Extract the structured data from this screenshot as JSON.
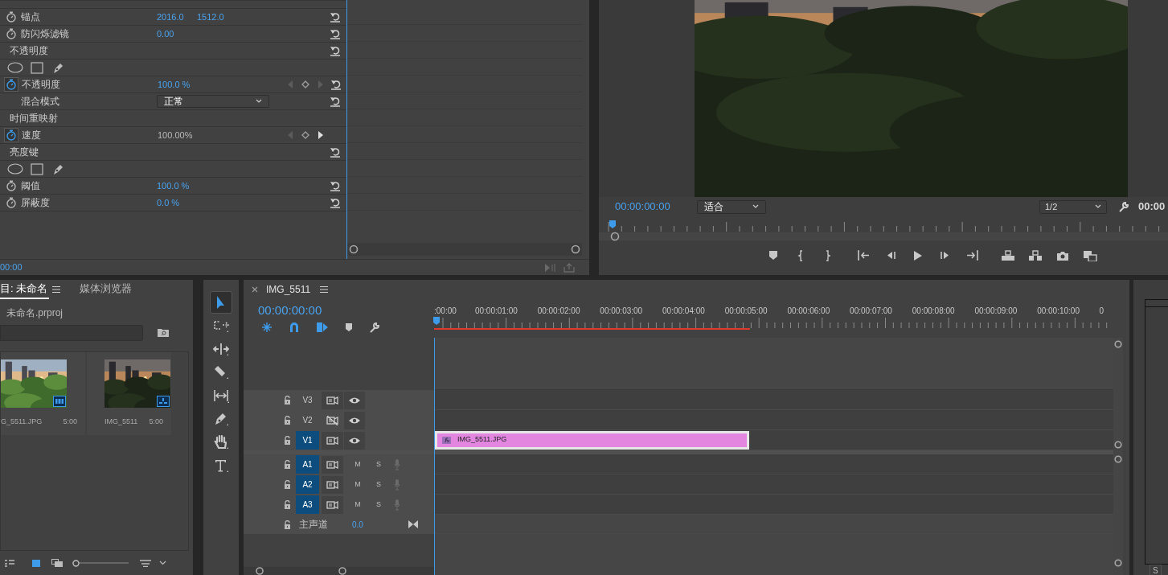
{
  "effect_controls": {
    "rows": [
      {
        "kind": "param",
        "label": "锚点",
        "values": [
          "2016.0",
          "1512.0"
        ],
        "editable": true,
        "animated": false,
        "keyframes": false,
        "reset": true
      },
      {
        "kind": "param",
        "label": "防闪烁滤镜",
        "values": [
          "0.00"
        ],
        "editable": true,
        "animated": false,
        "keyframes": false,
        "reset": true
      },
      {
        "kind": "section",
        "label": "不透明度",
        "reset": true
      },
      {
        "kind": "masks"
      },
      {
        "kind": "param",
        "label": "不透明度",
        "values": [
          "100.0 %"
        ],
        "editable": true,
        "animated": true,
        "keyframes": true,
        "reset": true
      },
      {
        "kind": "dropdown",
        "label": "混合模式",
        "value": "正常",
        "reset": true
      },
      {
        "kind": "section",
        "label": "时间重映射",
        "reset": false
      },
      {
        "kind": "param",
        "label": "速度",
        "values": [
          "100.00%"
        ],
        "editable": false,
        "animated": true,
        "keyframes": true,
        "reset": false
      },
      {
        "kind": "section",
        "label": "亮度键",
        "reset": true
      },
      {
        "kind": "masks"
      },
      {
        "kind": "param",
        "label": "阈值",
        "values": [
          "100.0 %"
        ],
        "editable": true,
        "animated": false,
        "keyframes": false,
        "reset": true
      },
      {
        "kind": "param",
        "label": "屏蔽度",
        "values": [
          "0.0 %"
        ],
        "editable": true,
        "animated": false,
        "keyframes": false,
        "reset": true
      }
    ],
    "timecode": "00:00"
  },
  "program_monitor": {
    "timecode": "00:00:00:00",
    "fit": "适合",
    "resolution": "1/2",
    "duration": "00:00"
  },
  "project": {
    "zoom": {
      "level": 0
    },
    "tabs": [
      {
        "label": "目: 未命名",
        "selected": true
      },
      {
        "label": "媒体浏览器",
        "selected": false
      }
    ],
    "path": "未命名.prproj",
    "items": [
      {
        "name": "G_5511.JPG",
        "duration": "5:00",
        "kind": "still"
      },
      {
        "name": "IMG_5511",
        "duration": "5:00",
        "kind": "sequence"
      }
    ]
  },
  "tools": [
    {
      "kind": "selection",
      "selected": true
    },
    {
      "kind": "track-select",
      "selected": false
    },
    {
      "kind": "ripple",
      "selected": false
    },
    {
      "kind": "razor",
      "selected": false
    },
    {
      "kind": "slip",
      "selected": false
    },
    {
      "kind": "pen",
      "selected": false
    },
    {
      "kind": "hand",
      "selected": false
    },
    {
      "kind": "type",
      "selected": false
    }
  ],
  "timeline": {
    "sequence": "IMG_5511",
    "timecode": "00:00:00:00",
    "ruler": [
      ":00:00",
      "00:00:01:00",
      "00:00:02:00",
      "00:00:03:00",
      "00:00:04:00",
      "00:00:05:00",
      "00:00:06:00",
      "00:00:07:00",
      "00:00:08:00",
      "00:00:09:00",
      "00:00:10:00",
      "0"
    ],
    "tracks": [
      {
        "kind": "video",
        "label": "V3",
        "targeted": false,
        "output": true
      },
      {
        "kind": "video",
        "label": "V2",
        "targeted": false,
        "output": false
      },
      {
        "kind": "video",
        "label": "V1",
        "targeted": true,
        "output": true,
        "clip": "IMG_5511.JPG"
      },
      {
        "kind": "audio",
        "label": "A1",
        "targeted": true,
        "mute": "M",
        "solo": "S"
      },
      {
        "kind": "audio",
        "label": "A2",
        "targeted": true,
        "mute": "M",
        "solo": "S"
      },
      {
        "kind": "audio",
        "label": "A3",
        "targeted": true,
        "mute": "M",
        "solo": "S"
      }
    ],
    "master": {
      "label": "主声道",
      "value": "0.0"
    }
  },
  "meter": {
    "solo": "S"
  }
}
